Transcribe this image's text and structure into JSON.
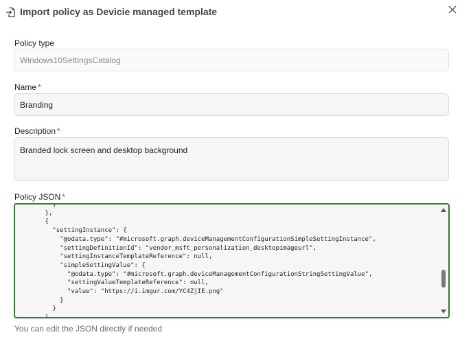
{
  "dialog": {
    "title": "Import policy as Devicie managed template",
    "icon": "import-icon",
    "close_icon": "close-icon"
  },
  "policy_type": {
    "label": "Policy type",
    "value": "Windows10SettingsCatalog"
  },
  "name": {
    "label": "Name",
    "required_mark": "*",
    "value": "Branding"
  },
  "description": {
    "label": "Description",
    "required_mark": "*",
    "value": "Branded lock screen and desktop background"
  },
  "policy_json": {
    "label": "Policy JSON",
    "required_mark": "*",
    "code": "        ]\n      },\n      {\n        \"settingInstance\": {\n          \"@odata.type\": \"#microsoft.graph.deviceManagementConfigurationSimpleSettingInstance\",\n          \"settingDefinitionId\": \"vendor_msft_personalization_desktopimageurl\",\n          \"settingInstanceTemplateReference\": null,\n          \"simpleSettingValue\": {\n            \"@odata.type\": \"#microsoft.graph.deviceManagementConfigurationStringSettingValue\",\n            \"settingValueTemplateReference\": null,\n            \"value\": \"https://i.imgur.com/YC4ZjIE.png\"\n          }\n        }\n      },\n",
    "help_text": "You can edit the JSON directly if needed"
  },
  "colors": {
    "required": "#d13438",
    "focus_border": "#2f7d32"
  }
}
